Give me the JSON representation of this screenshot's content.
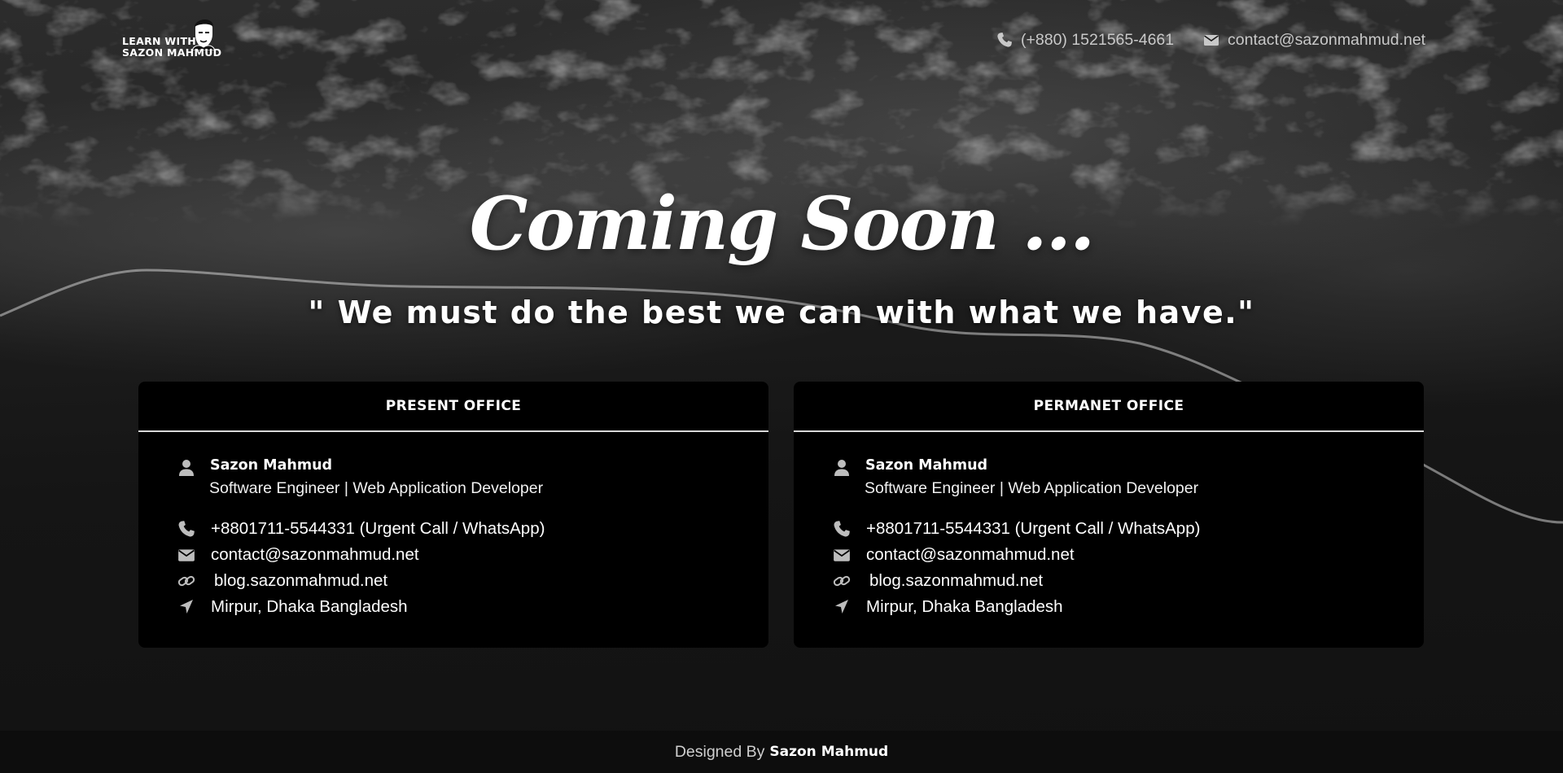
{
  "header": {
    "logo_line1": "LEARN WITH",
    "logo_line2": "SAZON MAHMUD",
    "phone": "(+880) 1521565-4661",
    "email": "contact@sazonmahmud.net"
  },
  "hero": {
    "title": "Coming Soon ...",
    "quote": "\" We must do the best we can with what we have.\""
  },
  "cards": [
    {
      "heading": "PRESENT OFFICE",
      "name": "Sazon Mahmud",
      "role": "Software Engineer | Web Application Developer",
      "phone": "+8801711-5544331 (Urgent Call / WhatsApp)",
      "email": "contact@sazonmahmud.net",
      "blog": "blog.sazonmahmud.net",
      "location": "Mirpur, Dhaka Bangladesh"
    },
    {
      "heading": "PERMANET OFFICE",
      "name": "Sazon Mahmud",
      "role": "Software Engineer | Web Application Developer",
      "phone": "+8801711-5544331 (Urgent Call / WhatsApp)",
      "email": "contact@sazonmahmud.net",
      "blog": "blog.sazonmahmud.net",
      "location": "Mirpur, Dhaka Bangladesh"
    }
  ],
  "footer": {
    "prefix": "Designed By",
    "author": "Sazon Mahmud"
  },
  "icons": {
    "phone": "phone-icon",
    "email": "envelope-icon",
    "user": "user-icon",
    "link": "link-icon",
    "location": "location-arrow-icon"
  },
  "colors": {
    "background": "#141414",
    "card": "#000000",
    "accent_text": "#ffffff",
    "muted_text": "#c9c9c9"
  }
}
